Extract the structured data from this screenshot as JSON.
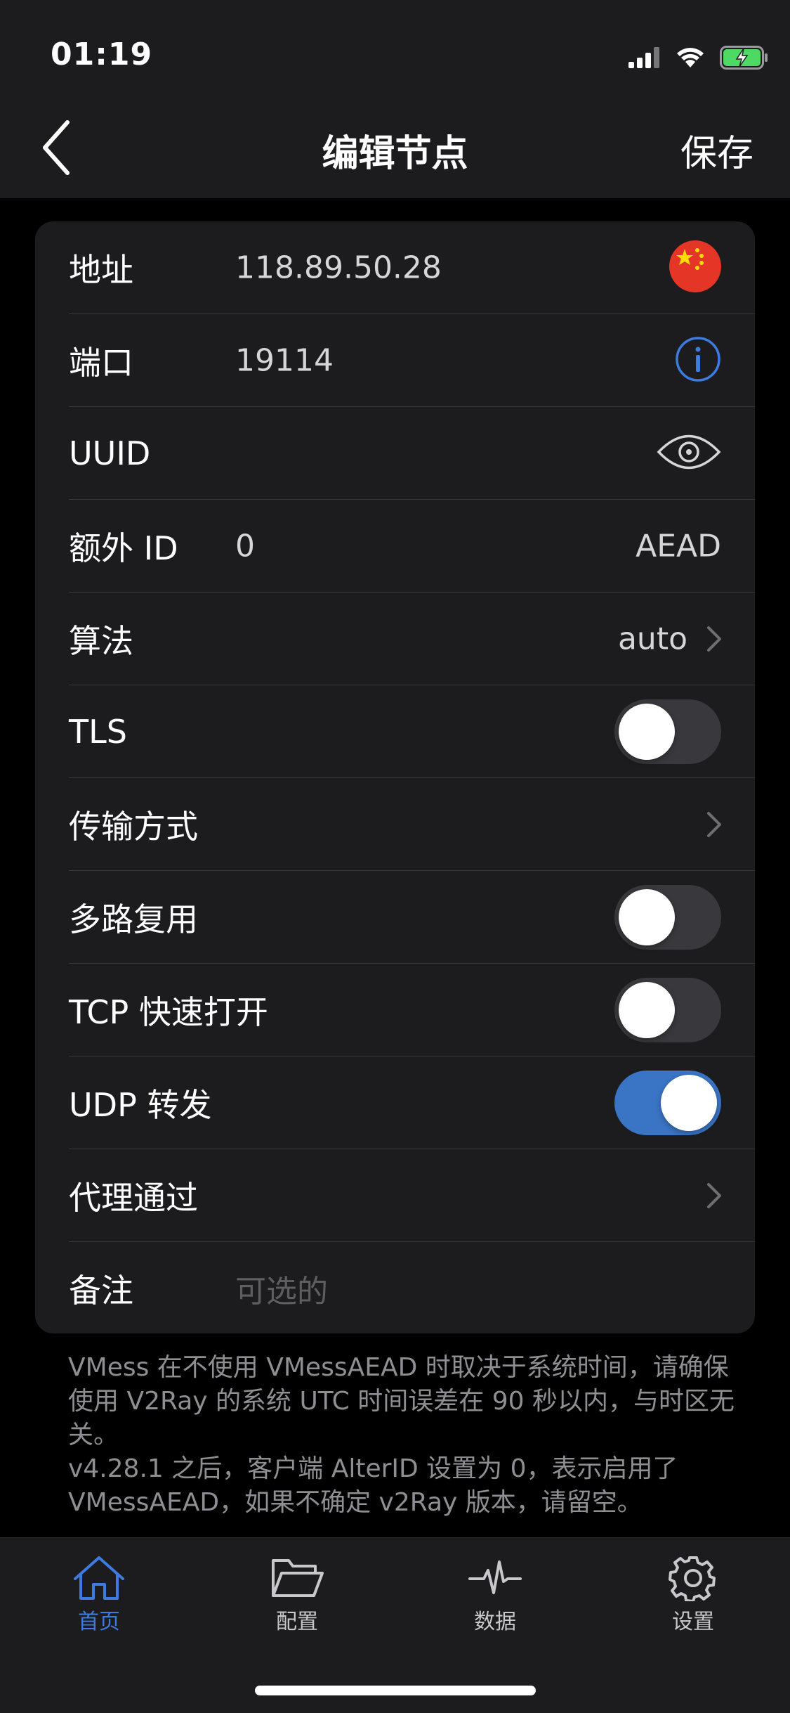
{
  "status_bar": {
    "time": "01:19"
  },
  "nav": {
    "title": "编辑节点",
    "save_label": "保存"
  },
  "form": {
    "address": {
      "label": "地址",
      "value": "118.89.50.28",
      "flag": "china-flag"
    },
    "port": {
      "label": "端口",
      "value": "19114"
    },
    "uuid": {
      "label": "UUID",
      "value": ""
    },
    "alter_id": {
      "label": "额外 ID",
      "value": "0",
      "right_text": "AEAD"
    },
    "algorithm": {
      "label": "算法",
      "value": "auto"
    },
    "tls": {
      "label": "TLS",
      "on": false
    },
    "transport": {
      "label": "传输方式"
    },
    "mux": {
      "label": "多路复用",
      "on": false
    },
    "tcp_fast_open": {
      "label": "TCP 快速打开",
      "on": false
    },
    "udp_relay": {
      "label": "UDP 转发",
      "on": true
    },
    "proxy_via": {
      "label": "代理通过"
    },
    "remark": {
      "label": "备注",
      "placeholder": "可选的"
    }
  },
  "footnote": {
    "line1": "VMess 在不使用 VMessAEAD 时取决于系统时间，请确保使用 V2Ray 的系统 UTC 时间误差在 90 秒以内，与时区无关。",
    "line2": "v4.28.1 之后，客户端 AlterID 设置为 0，表示启用了 VMessAEAD，如果不确定 v2Ray 版本，请留空。"
  },
  "tabs": [
    {
      "label": "首页",
      "icon": "home-icon",
      "active": true
    },
    {
      "label": "配置",
      "icon": "folder-icon",
      "active": false
    },
    {
      "label": "数据",
      "icon": "pulse-icon",
      "active": false
    },
    {
      "label": "设置",
      "icon": "gear-icon",
      "active": false
    }
  ],
  "colors": {
    "background": "#000000",
    "card": "#1c1c1e",
    "accent": "#3a74c4",
    "info_icon": "#3d7be0",
    "secondary_text": "#8e8e93"
  }
}
